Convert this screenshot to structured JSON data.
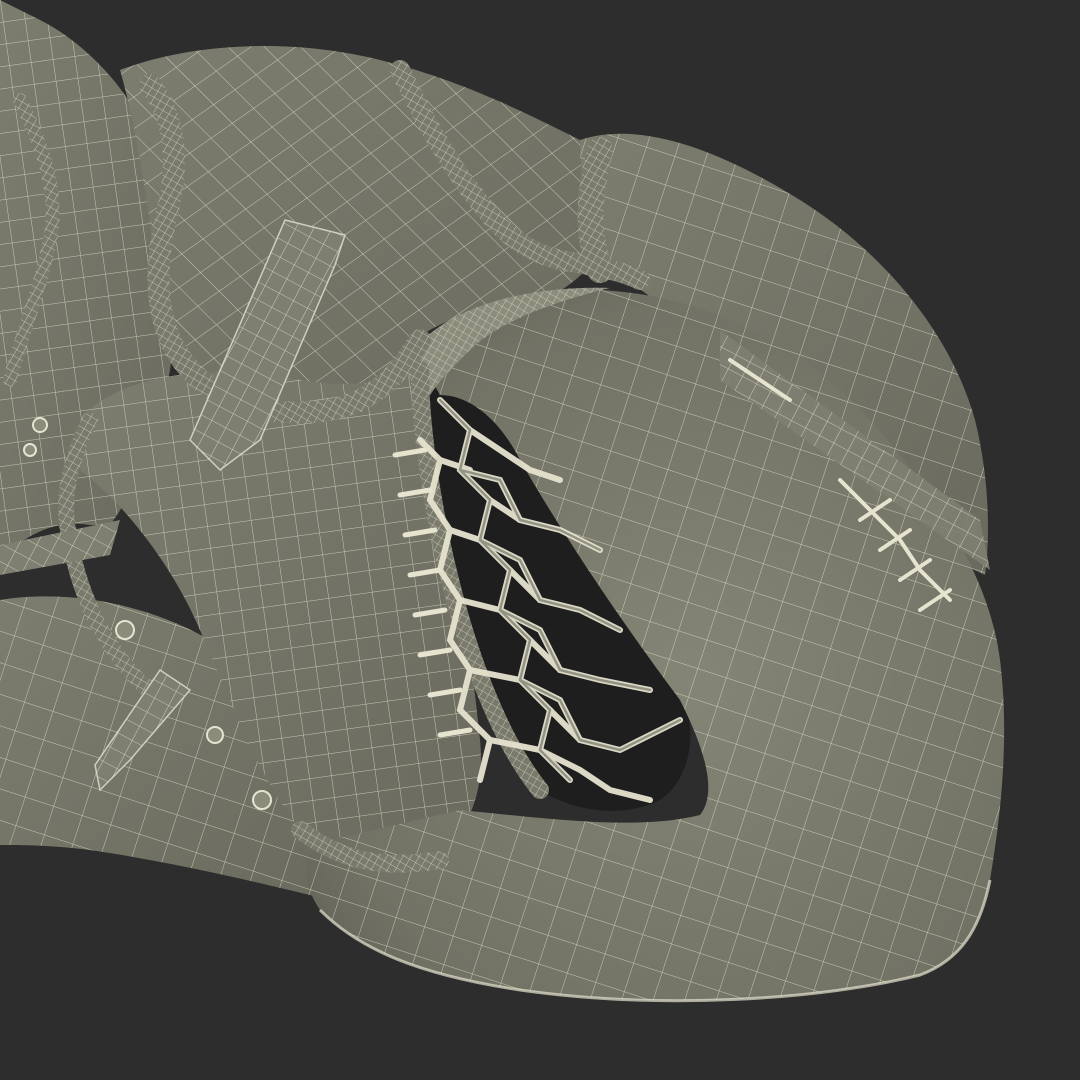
{
  "scene": {
    "subject": "goalie-catcher-glove-wireframe",
    "render_style": "wireframe-over-shaded",
    "colors": {
      "background": "#2d2d2d",
      "surface": "#767668",
      "surface_light": "#8c8c7d",
      "surface_dark": "#5c5c50",
      "wire": "#e6e3cf",
      "hole": "#1e1e1e"
    }
  }
}
